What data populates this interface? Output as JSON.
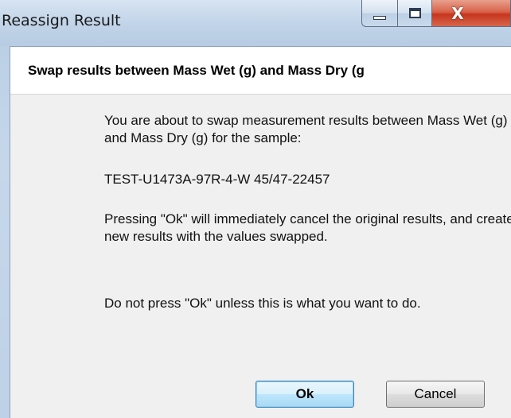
{
  "window": {
    "title": "Reassign Result",
    "controls": {
      "minimize": "minimize-icon",
      "maximize": "maximize-icon",
      "close_glyph": "X"
    }
  },
  "dialog": {
    "heading": "Swap results between Mass Wet (g) and Mass Dry (g",
    "message": {
      "intro": "You are about to swap measurement results between Mass Wet (g) and Mass Dry (g) for the sample:",
      "sample": "TEST-U1473A-97R-4-W 45/47-22457",
      "consequence": "Pressing \"Ok\" will immediately cancel the original results, and create new results with the values swapped.",
      "warning": "Do not press \"Ok\" unless this is what you want to do."
    }
  },
  "buttons": {
    "ok_label": "Ok",
    "cancel_label": "Cancel"
  },
  "colors": {
    "accent": "#3c7fb1",
    "close": "#c7351f"
  }
}
